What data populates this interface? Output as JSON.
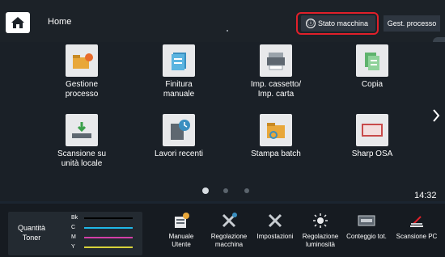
{
  "topbar": {
    "title": "Home",
    "status_button": "Stato macchina",
    "job_button": "Gest. processo",
    "status_icon": "ⓘ"
  },
  "apps": [
    {
      "label": "Gestione\nprocesso",
      "icon": "folder-gear-icon"
    },
    {
      "label": "Finitura\nmanuale",
      "icon": "document-stack-icon"
    },
    {
      "label": "Imp. cassetto/\nImp. carta",
      "icon": "printer-tray-icon"
    },
    {
      "label": "Copia",
      "icon": "copy-icon"
    },
    {
      "label": "Scansione su\nunità locale",
      "icon": "scan-to-local-icon"
    },
    {
      "label": "Lavori recenti",
      "icon": "recent-jobs-icon"
    },
    {
      "label": "Stampa batch",
      "icon": "folder-search-icon"
    },
    {
      "label": "Sharp OSA",
      "icon": "sharp-osa-icon"
    }
  ],
  "time": "14:32",
  "toner": {
    "label": "Quantità\nToner",
    "channels": [
      {
        "name": "Bk",
        "color": "#000000"
      },
      {
        "name": "C",
        "color": "#1fb8e8"
      },
      {
        "name": "M",
        "color": "#d43fa8"
      },
      {
        "name": "Y",
        "color": "#d8d23a"
      }
    ]
  },
  "tools": [
    {
      "label": "Manuale\nUtente",
      "icon": "manual-icon"
    },
    {
      "label": "Regolazione\nmacchina",
      "icon": "tools-icon"
    },
    {
      "label": "Impostazioni",
      "icon": "settings-tools-icon"
    },
    {
      "label": "Regolazione\nluminosità",
      "icon": "brightness-icon"
    },
    {
      "label": "Conteggio tot.",
      "icon": "counter-icon"
    },
    {
      "label": "Scansione PC",
      "icon": "scan-pc-icon"
    }
  ],
  "colors": {
    "accent_red": "#e0202a",
    "page_active": "#d8dde2",
    "page_inactive": "#5b646d"
  }
}
